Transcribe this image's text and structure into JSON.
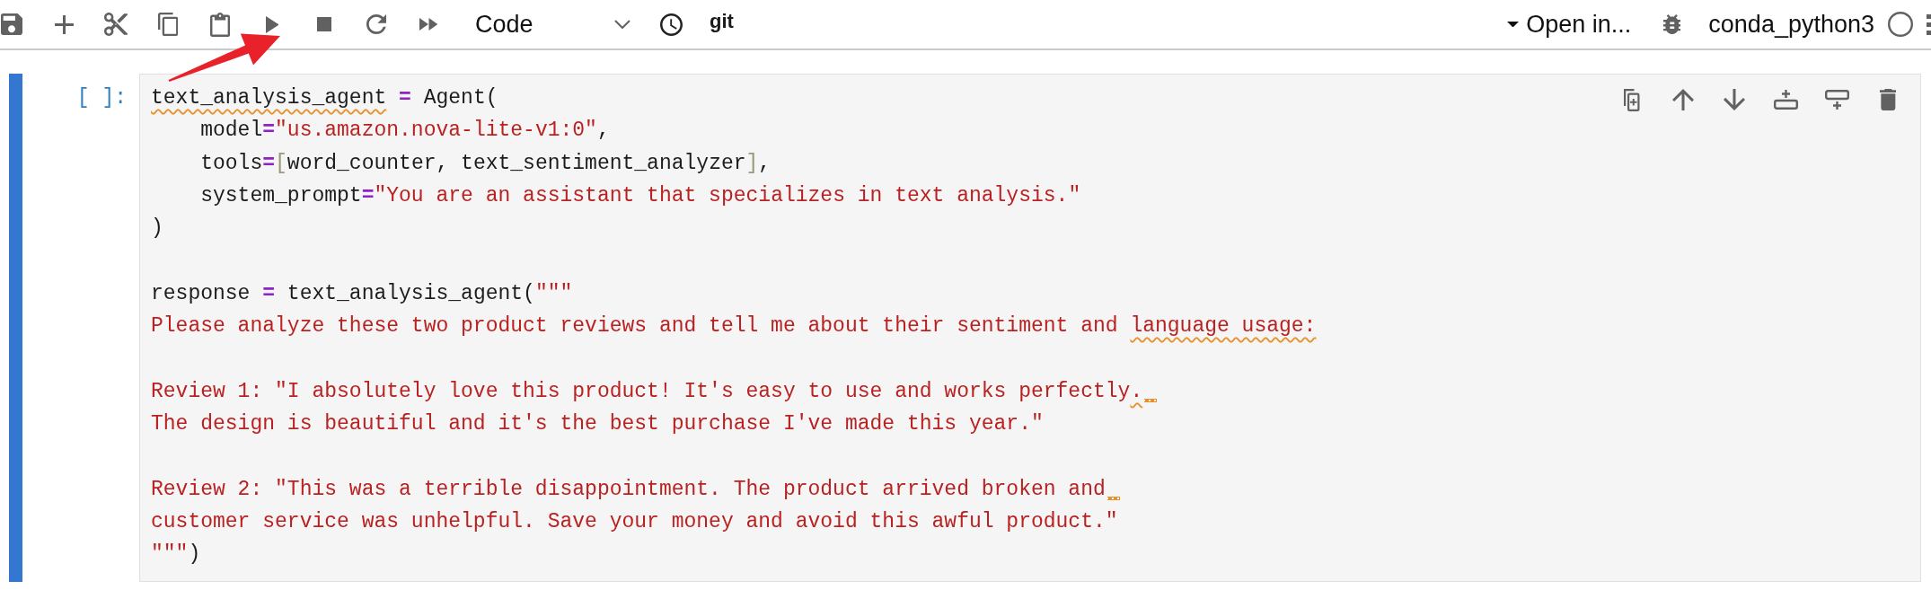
{
  "toolbar": {
    "cell_type": "Code",
    "git_label": "git",
    "open_in": "Open in...",
    "kernel": {
      "name": "conda_python3",
      "busy": false
    }
  },
  "cell": {
    "active": true,
    "prompt": "[ ]:",
    "paragraphs": [
      {
        "lines": [
          {
            "tokens": [
              {
                "kind": "name",
                "text": "text_analysis_agent",
                "flagged": true
              },
              {
                "kind": "operator",
                "text": " = ",
                "flagged": false
              },
              {
                "kind": "name",
                "text": "Agent(",
                "flagged": false
              }
            ],
            "trailing_squiggle": false
          },
          {
            "tokens": [
              {
                "kind": "name",
                "text": "    model",
                "flagged": false
              },
              {
                "kind": "operator",
                "text": "=",
                "flagged": false
              },
              {
                "kind": "string",
                "text": "\"us.amazon.nova-lite-v1:0\"",
                "flagged": false
              },
              {
                "kind": "name",
                "text": ",",
                "flagged": false
              }
            ],
            "trailing_squiggle": false
          },
          {
            "tokens": [
              {
                "kind": "name",
                "text": "    tools",
                "flagged": false
              },
              {
                "kind": "operator",
                "text": "=",
                "flagged": false
              },
              {
                "kind": "bracket",
                "text": "[",
                "flagged": false
              },
              {
                "kind": "name",
                "text": "word_counter, text_sentiment_analyzer",
                "flagged": false
              },
              {
                "kind": "bracket",
                "text": "]",
                "flagged": false
              },
              {
                "kind": "name",
                "text": ",",
                "flagged": false
              }
            ],
            "trailing_squiggle": false
          },
          {
            "tokens": [
              {
                "kind": "name",
                "text": "    system_prompt",
                "flagged": false
              },
              {
                "kind": "operator",
                "text": "=",
                "flagged": false
              },
              {
                "kind": "string",
                "text": "\"You are an assistant that specializes in text analysis.\"",
                "flagged": false
              }
            ],
            "trailing_squiggle": false
          },
          {
            "tokens": [
              {
                "kind": "name",
                "text": ")",
                "flagged": false
              }
            ],
            "trailing_squiggle": false
          }
        ]
      },
      {
        "lines": [
          {
            "tokens": [
              {
                "kind": "name",
                "text": "response",
                "flagged": false
              },
              {
                "kind": "operator",
                "text": " = ",
                "flagged": false
              },
              {
                "kind": "name",
                "text": "text_analysis_agent(",
                "flagged": false
              },
              {
                "kind": "string",
                "text": "\"\"\"",
                "flagged": false
              }
            ],
            "trailing_squiggle": false
          },
          {
            "tokens": [
              {
                "kind": "string",
                "text": "Please analyze these two product reviews and tell me about their sentiment and ",
                "flagged": false
              },
              {
                "kind": "string",
                "text": "language usage:",
                "flagged": true
              }
            ],
            "trailing_squiggle": false
          }
        ]
      },
      {
        "lines": [
          {
            "tokens": [
              {
                "kind": "string",
                "text": "Review 1: \"I absolutely love this product! It's easy to use and works perfectly",
                "flagged": false
              },
              {
                "kind": "string",
                "text": ".",
                "flagged": true
              }
            ],
            "trailing_squiggle": true
          },
          {
            "tokens": [
              {
                "kind": "string",
                "text": "The design is beautiful and it's the best purchase I've made this year.\"",
                "flagged": false
              }
            ],
            "trailing_squiggle": false
          }
        ]
      },
      {
        "lines": [
          {
            "tokens": [
              {
                "kind": "string",
                "text": "Review 2: \"This was a terrible disappointment. The product arrived broken and",
                "flagged": false
              }
            ],
            "trailing_squiggle": true
          },
          {
            "tokens": [
              {
                "kind": "string",
                "text": "customer service was unhelpful. Save your money and avoid this awful product.\"",
                "flagged": false
              }
            ],
            "trailing_squiggle": false
          },
          {
            "tokens": [
              {
                "kind": "string",
                "text": "\"\"\"",
                "flagged": false
              },
              {
                "kind": "name",
                "text": ")",
                "flagged": false
              }
            ],
            "trailing_squiggle": false
          }
        ]
      }
    ]
  }
}
